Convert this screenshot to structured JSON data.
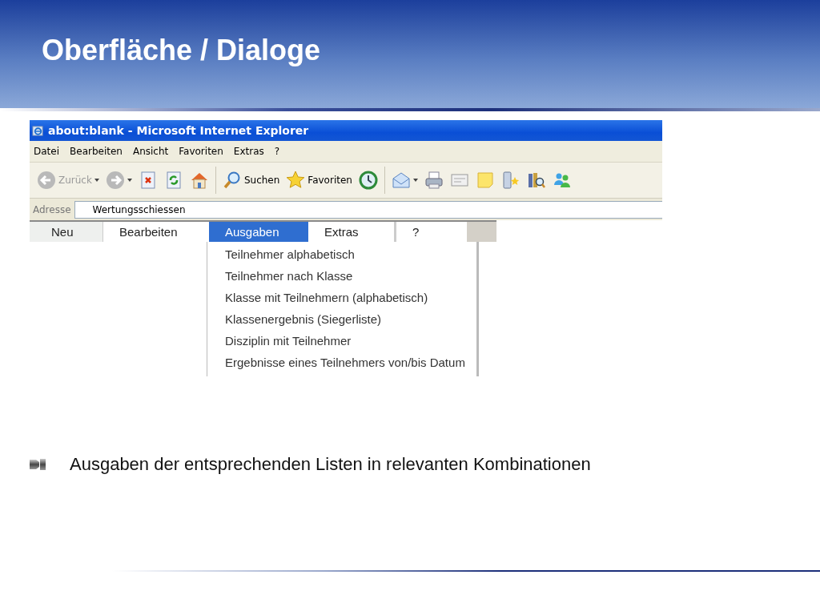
{
  "slide": {
    "title": "Oberfläche / Dialoge"
  },
  "window": {
    "title": "about:blank - Microsoft Internet Explorer"
  },
  "menu_bar": [
    "Datei",
    "Bearbeiten",
    "Ansicht",
    "Favoriten",
    "Extras",
    "?"
  ],
  "toolbar": [
    {
      "kind": "back",
      "label": "Zurück",
      "disabled": true,
      "dropdown": true
    },
    {
      "kind": "forward",
      "disabled": true,
      "dropdown": true
    },
    {
      "kind": "stop",
      "disabled": false
    },
    {
      "kind": "refresh",
      "disabled": false
    },
    {
      "kind": "home",
      "disabled": false
    },
    {
      "kind": "separator"
    },
    {
      "kind": "search",
      "label": "Suchen",
      "disabled": false
    },
    {
      "kind": "favorites",
      "label": "Favoriten",
      "disabled": false
    },
    {
      "kind": "history",
      "disabled": false
    },
    {
      "kind": "separator"
    },
    {
      "kind": "mail",
      "disabled": false,
      "dropdown": true
    },
    {
      "kind": "print",
      "disabled": false
    },
    {
      "kind": "edit",
      "disabled": false
    },
    {
      "kind": "note",
      "disabled": false
    },
    {
      "kind": "phone",
      "disabled": false
    },
    {
      "kind": "research",
      "disabled": false
    },
    {
      "kind": "messenger",
      "disabled": false
    }
  ],
  "address": {
    "label": "Adresse",
    "value": "Wertungsschiessen"
  },
  "app_menu": [
    {
      "label": "Neu",
      "selected": false
    },
    {
      "label": "Bearbeiten",
      "selected": false
    },
    {
      "label": "Ausgaben",
      "selected": true
    },
    {
      "label": "Extras",
      "selected": false
    },
    {
      "label": "?",
      "selected": false
    }
  ],
  "dropdown_items": [
    "Teilnehmer alphabetisch",
    "Teilnehmer nach Klasse",
    "Klasse mit Teilnehmern (alphabetisch)",
    "Klassenergebnis (Siegerliste)",
    "Disziplin mit Teilnehmer",
    "Ergebnisse eines Teilnehmers von/bis Datum"
  ],
  "bullets": [
    "Ausgaben der entsprechenden Listen in relevanten Kombinationen"
  ]
}
